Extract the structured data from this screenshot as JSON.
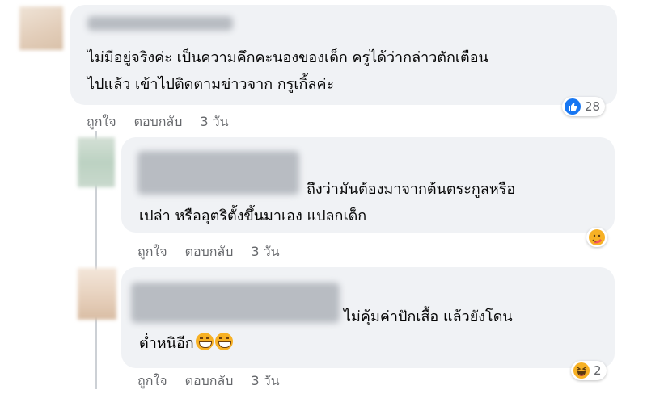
{
  "comments": [
    {
      "text_lines": [
        "ไม่มีอยู่จริงค่ะ เป็นความคึกคะนองของเด็ก ครูได้ว่ากล่าวตักเตือน",
        "ไปแล้ว เข้าไปติดตามข่าวจาก กรูเกิ้ลค่ะ"
      ],
      "actions": {
        "like": "ถูกใจ",
        "reply": "ตอบกลับ",
        "time": "3 วัน"
      },
      "reaction": {
        "icon": "like-icon",
        "count": "28",
        "color": "#1877f2"
      }
    },
    {
      "text_lines": [
        "ถึงว่ามันต้องมาจากต้นตระกูลหรือ",
        "เปล่า หรืออุตริตั้งขึ้นมาเอง แปลกเด็ก"
      ],
      "actions": {
        "like": "ถูกใจ",
        "reply": "ตอบกลับ",
        "time": "3 วัน"
      },
      "reaction": {
        "icon": "care-emoji-icon",
        "count": ""
      }
    },
    {
      "text_lines": [
        "ไม่คุ้มค่าปักเสื้อ แล้วยังโดน",
        "ต่ำหนิอีก"
      ],
      "actions": {
        "like": "ถูกใจ",
        "reply": "ตอบกลับ",
        "time": "3 วัน"
      },
      "reaction": {
        "icon": "haha-emoji-icon",
        "count": "2"
      }
    }
  ],
  "colors": {
    "bubble": "#f0f2f5",
    "meta": "#65676b",
    "like_blue": "#1877f2",
    "emoji_yellow": "#f7b125"
  }
}
